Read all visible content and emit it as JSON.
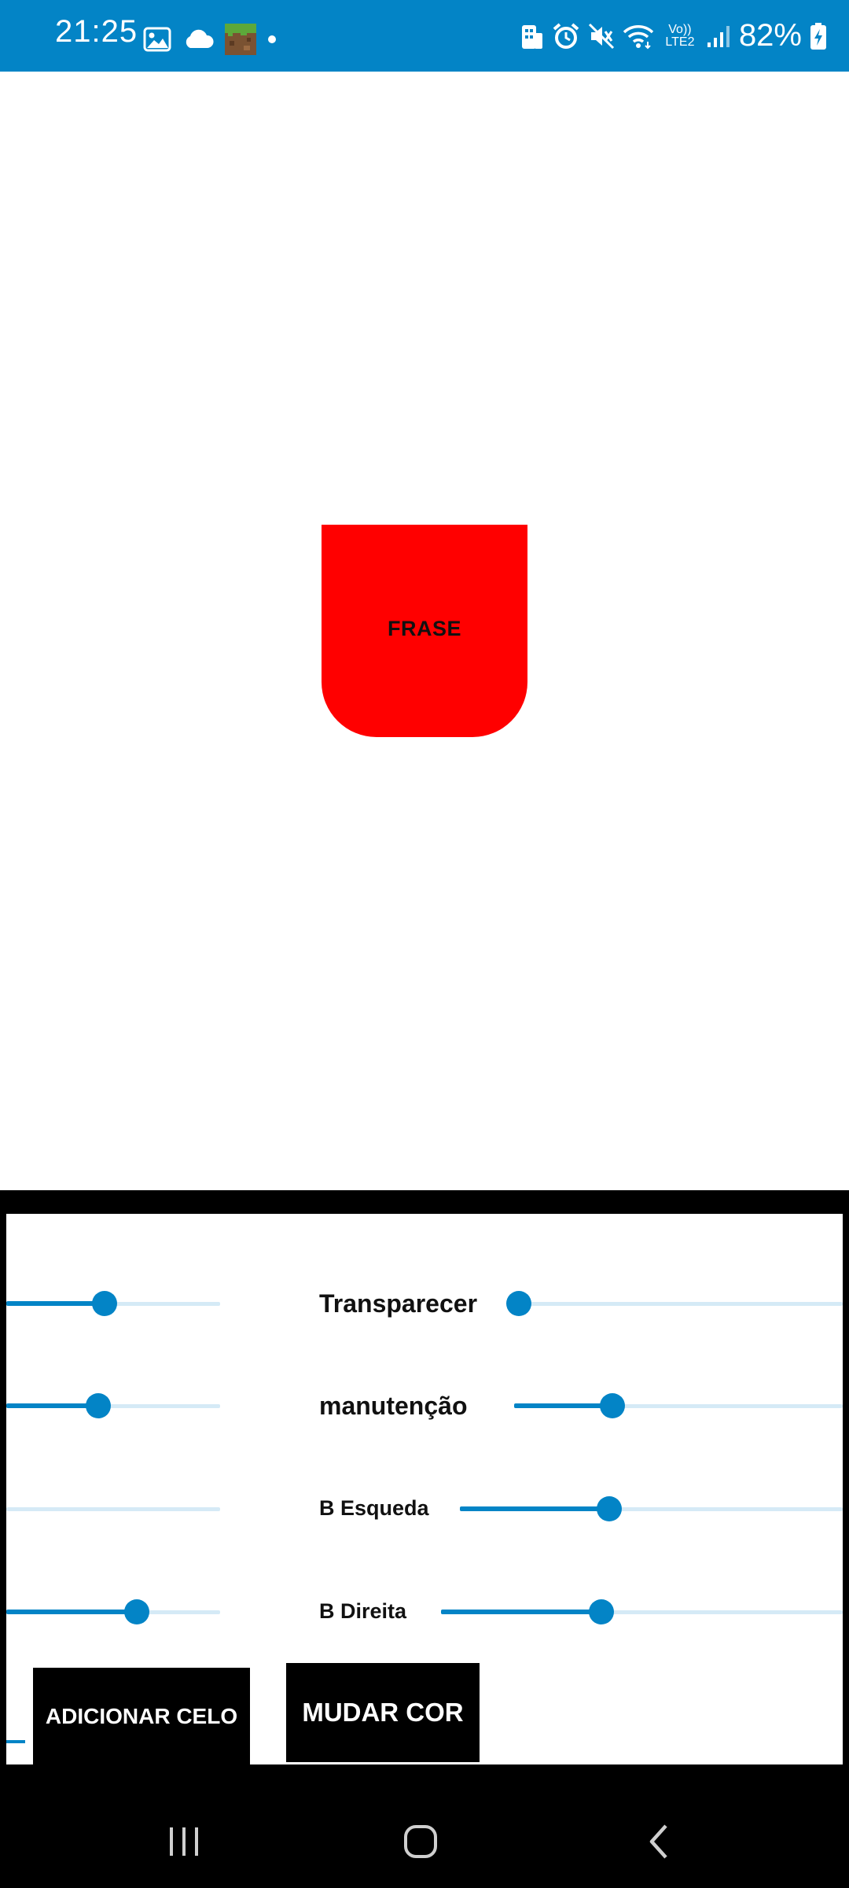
{
  "status_bar": {
    "time": "21:25",
    "battery": "82%",
    "network_label": "Vo)) LTE2",
    "left_icons": [
      "gallery-icon",
      "cloud-icon",
      "minecraft-app-icon",
      "dot-icon"
    ],
    "right_icons": [
      "building-icon",
      "alarm-icon",
      "mute-icon",
      "wifi-icon",
      "lte-icon",
      "signal-icon",
      "battery-charging-icon"
    ]
  },
  "canvas": {
    "shape_label": "FRASE",
    "shape_color": "#ff0000"
  },
  "controls": {
    "sliders": [
      {
        "id": "left-1",
        "value": 0.46
      },
      {
        "id": "transparecer",
        "label": "Transparecer",
        "value": 0.0
      },
      {
        "id": "left-2",
        "value": 0.43
      },
      {
        "id": "manutencao",
        "label": "manutenção",
        "value": 0.3
      },
      {
        "id": "left-3",
        "value": 0.0
      },
      {
        "id": "b-esqueda",
        "label": "B Esqueda",
        "value": 0.39
      },
      {
        "id": "left-4",
        "value": 0.61
      },
      {
        "id": "b-direita",
        "label": "B Direita",
        "value": 0.4
      }
    ],
    "add_button": "ADICIONAR CELO",
    "color_button": "MUDAR COR"
  },
  "accent_color": "#0384C6",
  "nav_bar": {
    "icons": [
      "recents-icon",
      "home-icon",
      "back-icon"
    ]
  }
}
